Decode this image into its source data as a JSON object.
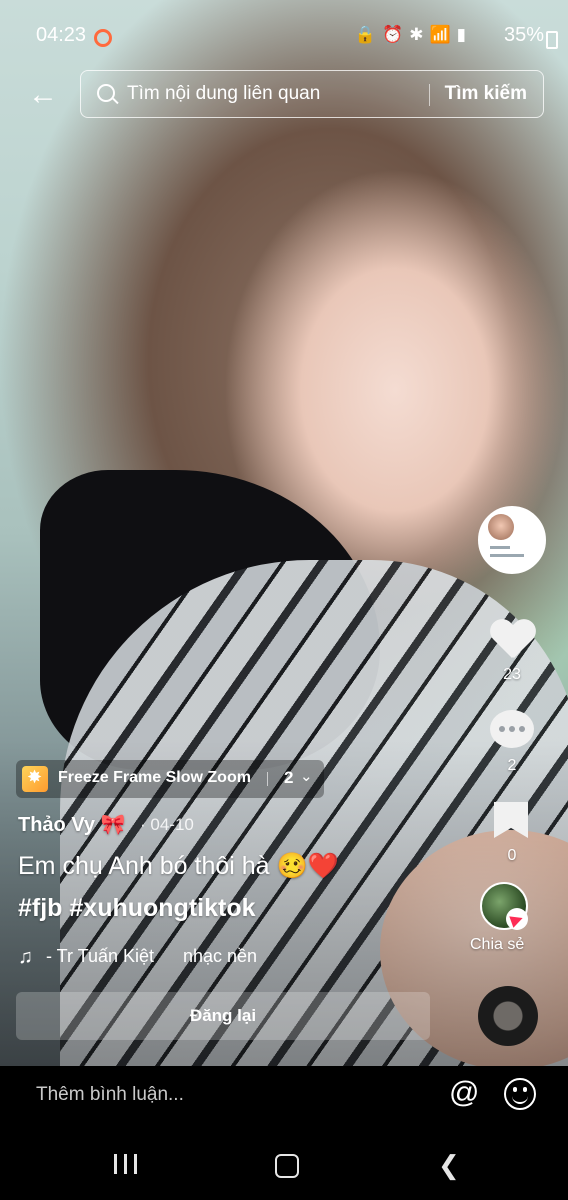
{
  "status": {
    "time": "04:23",
    "battery": "35%",
    "icons": [
      "lock-icon",
      "alarm-icon",
      "bluetooth-icon",
      "wifi-icon",
      "signal-icon"
    ]
  },
  "search": {
    "placeholder": "Tìm nội dung liên quan",
    "button": "Tìm kiếm"
  },
  "actions": {
    "likes": "23",
    "comments": "2",
    "bookmarks": "0",
    "share_label": "Chia sẻ"
  },
  "effect": {
    "label": "Freeze Frame Slow Zoom",
    "count": "2"
  },
  "post": {
    "username": "Thảo Vy 🎀",
    "date": "· 04-10",
    "caption": "Em chụ Anh bó thôi hà 🥴❤️",
    "hashtags": "#fjb #xuhuongtiktok",
    "music_author": "- Tr Tuấn Kiệt",
    "music_sub": "nhạc nền"
  },
  "repost": {
    "label": "Đăng lại"
  },
  "comment": {
    "placeholder": "Thêm bình luận..."
  },
  "colors": {
    "accent": "#fe2c55",
    "record_dot": "#ff6a3d"
  }
}
